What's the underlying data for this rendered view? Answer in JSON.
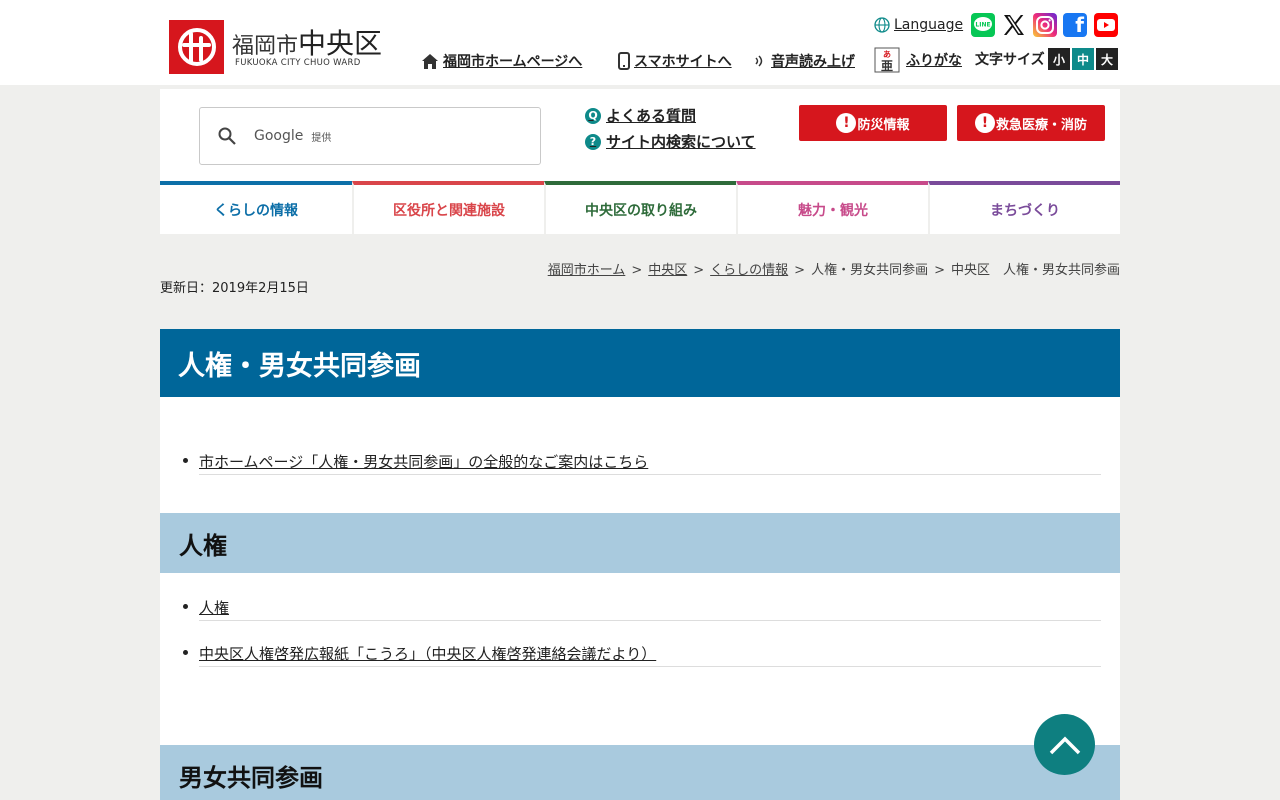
{
  "header": {
    "logo": {
      "city": "福岡市",
      "ward": "中央区",
      "subtitle": "FUKUOKA CITY CHUO WARD"
    },
    "links": {
      "home": "福岡市ホームページへ",
      "mobile": "スマホサイトへ",
      "voice": "音声読み上げ",
      "furigana": "ふりがな"
    },
    "language": "Language",
    "sns": {
      "line": "LINE",
      "x": "X",
      "instagram": "instagram-icon",
      "facebook": "f",
      "youtube": "youtube-icon"
    },
    "font_size": {
      "label": "文字サイズ",
      "small": "小",
      "medium": "中",
      "large": "大"
    }
  },
  "util": {
    "search": {
      "google": "Google",
      "provided": "提供"
    },
    "faq": "よくある質問",
    "search_help": "サイト内検索について",
    "faq_icon": "Q",
    "help_icon": "?",
    "disaster_btn": "防災情報",
    "emergency_btn": "救急医療・消防"
  },
  "nav": {
    "items": [
      {
        "label": "くらしの情報",
        "color": "#0d6fa8"
      },
      {
        "label": "区役所と関連施設",
        "color": "#d9454a"
      },
      {
        "label": "中央区の取り組み",
        "color": "#2e6b3a"
      },
      {
        "label": "魅力・観光",
        "color": "#c74a8a"
      },
      {
        "label": "まちづくり",
        "color": "#7a4b9a"
      }
    ]
  },
  "breadcrumb": {
    "items": [
      "福岡市ホーム",
      "中央区",
      "くらしの情報",
      "人権・男女共同参画",
      "中央区　人権・男女共同参画"
    ],
    "separator": ">"
  },
  "updated": "更新日：2019年2月15日",
  "main": {
    "title": "人権・男女共同参画",
    "intro_link": "市ホームページ「人権・男女共同参画」の全般的なご案内はこちら",
    "section1": {
      "heading": "人権",
      "links": [
        "人権",
        "中央区人権啓発広報紙「こうろ」（中央区人権啓発連絡会議だより）"
      ]
    },
    "section2": {
      "heading": "男女共同参画"
    }
  },
  "colors": {
    "brand_red": "#d6161d",
    "title_blue": "#006699",
    "section_blue": "#a9cade",
    "teal": "#0e8a8a"
  }
}
